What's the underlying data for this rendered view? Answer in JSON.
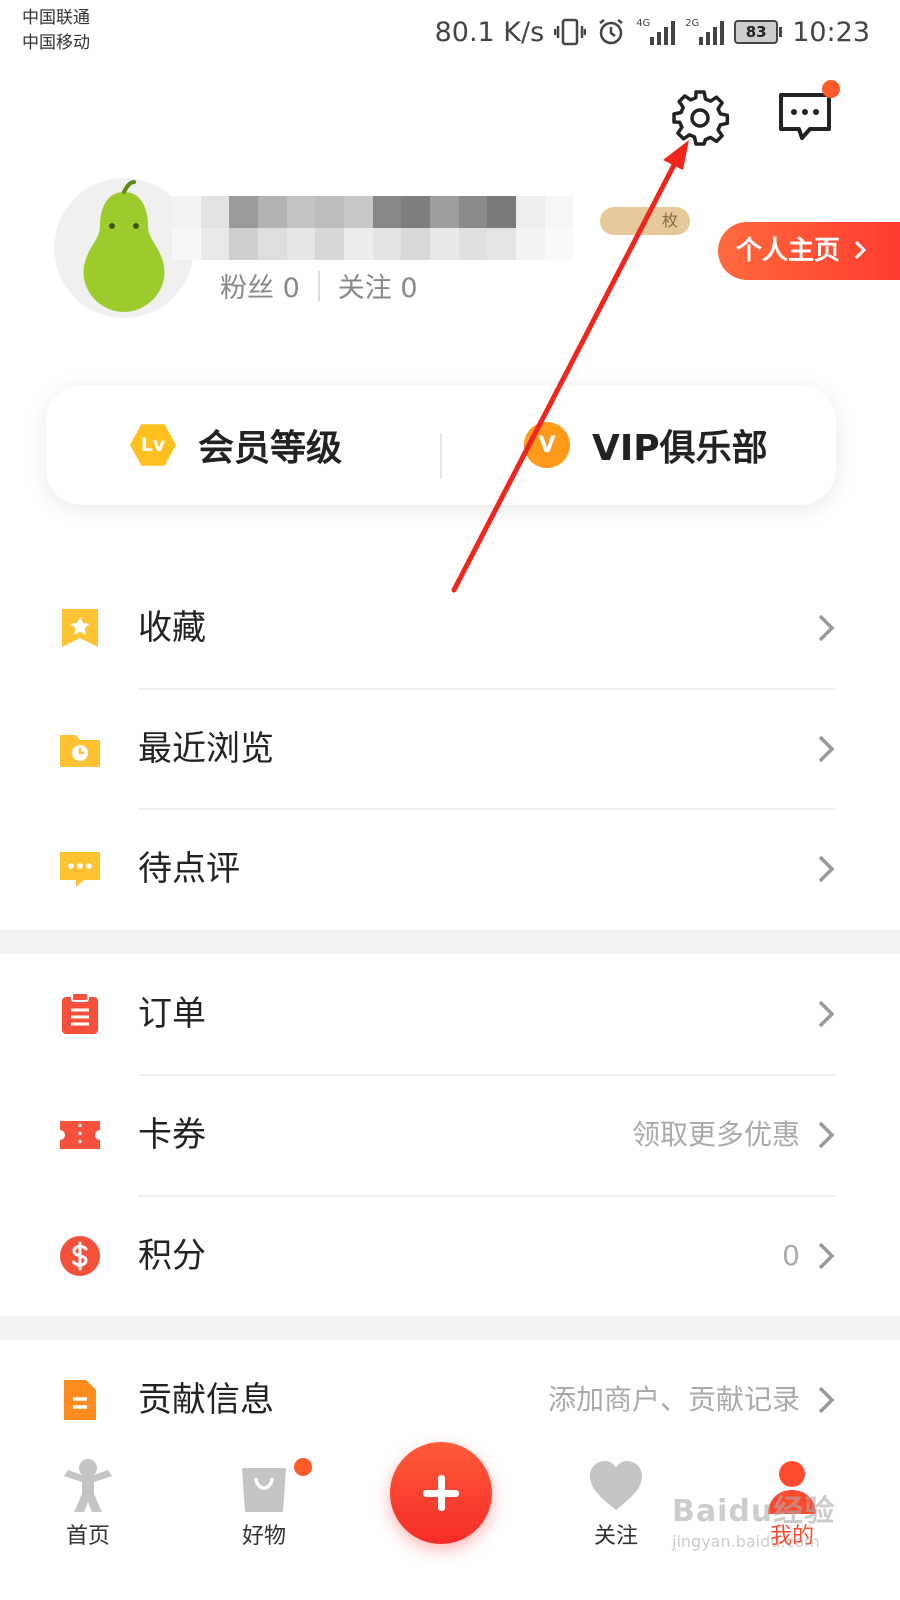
{
  "status_bar": {
    "carrier_1": "中国联通",
    "carrier_2": "中国移动",
    "net_speed": "80.1 K/s",
    "signal_1_tag": "4G",
    "signal_2_tag": "2G",
    "battery": "83",
    "time": "10:23"
  },
  "header": {
    "settings_icon": "gear-icon",
    "message_icon": "chat-bubble-icon"
  },
  "profile": {
    "medal_text": "枚",
    "fans_label": "粉丝 0",
    "following_label": "关注 0",
    "homepage_button": "个人主页"
  },
  "member_card": {
    "level_badge": "Lv",
    "level_label": "会员等级",
    "vip_badge": "V",
    "vip_label": "VIP俱乐部"
  },
  "list_group_1": [
    {
      "label": "收藏",
      "icon": "bookmark-star-icon",
      "extra": ""
    },
    {
      "label": "最近浏览",
      "icon": "folder-clock-icon",
      "extra": ""
    },
    {
      "label": "待点评",
      "icon": "comment-icon",
      "extra": ""
    }
  ],
  "list_group_2": [
    {
      "label": "订单",
      "icon": "clipboard-icon",
      "extra": ""
    },
    {
      "label": "卡券",
      "icon": "ticket-icon",
      "extra": "领取更多优惠"
    },
    {
      "label": "积分",
      "icon": "dollar-coin-icon",
      "extra": "0"
    }
  ],
  "list_group_3": [
    {
      "label": "贡献信息",
      "icon": "document-icon",
      "extra": "添加商户、贡献记录"
    }
  ],
  "bottom_nav": [
    {
      "label": "首页",
      "icon": "home-mascot-icon"
    },
    {
      "label": "好物",
      "icon": "shopping-bag-icon"
    },
    {
      "label": "",
      "icon": "plus-icon"
    },
    {
      "label": "关注",
      "icon": "heart-icon"
    },
    {
      "label": "我的",
      "icon": "user-icon"
    }
  ],
  "colors": {
    "accent": "#ff4a2e",
    "icon_yellow": "#ffc233",
    "icon_red": "#f5503c",
    "icon_orange": "#ff8a1e"
  },
  "watermark": {
    "main": "Baidu经验",
    "sub": "jingyan.baidu.com"
  }
}
